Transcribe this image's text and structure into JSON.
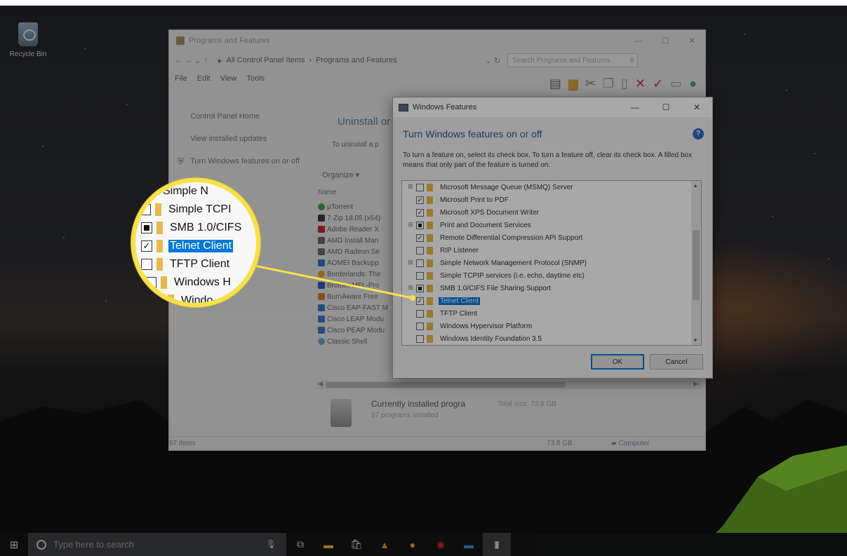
{
  "desktop": {
    "recycle_bin_label": "Recycle Bin"
  },
  "taskbar": {
    "search_placeholder": "Type here to search"
  },
  "programs_window": {
    "title": "Programs and Features",
    "address_path": [
      "All Control Panel Items",
      "Programs and Features"
    ],
    "search_placeholder": "Search Programs and Features",
    "menu": [
      "File",
      "Edit",
      "View",
      "Tools"
    ],
    "left_links": [
      "Control Panel Home",
      "View installed updates",
      "Turn Windows features on or off"
    ],
    "heading": "Uninstall or",
    "subheading": "To uninstall a p",
    "organize": "Organize ▾",
    "column_name": "Name",
    "programs": [
      {
        "name": "µTorrent",
        "color": "#3fa34d"
      },
      {
        "name": "7-Zip 18.05 (x64)",
        "color": "#3a3a3a"
      },
      {
        "name": "Adobe Reader X",
        "color": "#d0231c"
      },
      {
        "name": "AMD Install Man",
        "color": "#6a6a6a"
      },
      {
        "name": "AMD Radeon Se",
        "color": "#6a6a6a"
      },
      {
        "name": "AOMEI Backupp",
        "color": "#2d78c4"
      },
      {
        "name": "Borderlands: The",
        "color": "#e2a12c"
      },
      {
        "name": "Brother MFL-Pro",
        "color": "#2d5ca8"
      },
      {
        "name": "BurnAware Free",
        "color": "#e07a26"
      },
      {
        "name": "Cisco EAP-FAST M",
        "color": "#3579c7"
      },
      {
        "name": "Cisco LEAP Modu",
        "color": "#3579c7"
      },
      {
        "name": "Cisco PEAP Modu",
        "color": "#3579c7"
      },
      {
        "name": "Classic Shell",
        "color": "#5fa7d8"
      }
    ],
    "installed_title": "Currently installed progra",
    "installed_count": "97 programs installed",
    "total_size": "Total size:  73.8 GB",
    "status_items": "97 items",
    "status_size": "73.8 GB",
    "status_computer": "Computer"
  },
  "features_dialog": {
    "title": "Windows Features",
    "heading": "Turn Windows features on or off",
    "help": "?",
    "description": "To turn a feature on, select its check box. To turn a feature off, clear its check box. A filled box means that only part of the feature is turned on.",
    "features": [
      {
        "label": "Microsoft Message Queue (MSMQ) Server",
        "state": "unchecked",
        "expandable": true,
        "selected": false
      },
      {
        "label": "Microsoft Print to PDF",
        "state": "checked",
        "expandable": false,
        "selected": false
      },
      {
        "label": "Microsoft XPS Document Writer",
        "state": "checked",
        "expandable": false,
        "selected": false
      },
      {
        "label": "Print and Document Services",
        "state": "partial",
        "expandable": true,
        "selected": false
      },
      {
        "label": "Remote Differential Compression API Support",
        "state": "checked",
        "expandable": false,
        "selected": false
      },
      {
        "label": "RIP Listener",
        "state": "unchecked",
        "expandable": false,
        "selected": false
      },
      {
        "label": "Simple Network Management Protocol (SNMP)",
        "state": "unchecked",
        "expandable": true,
        "selected": false
      },
      {
        "label": "Simple TCPIP services (i.e. echo, daytime etc)",
        "state": "unchecked",
        "expandable": false,
        "selected": false
      },
      {
        "label": "SMB 1.0/CIFS File Sharing Support",
        "state": "partial",
        "expandable": true,
        "selected": false
      },
      {
        "label": "Telnet Client",
        "state": "checked",
        "expandable": false,
        "selected": true
      },
      {
        "label": "TFTP Client",
        "state": "unchecked",
        "expandable": false,
        "selected": false
      },
      {
        "label": "Windows Hypervisor Platform",
        "state": "unchecked",
        "expandable": false,
        "selected": false
      },
      {
        "label": "Windows Identity Foundation 3.5",
        "state": "unchecked",
        "expandable": false,
        "selected": false
      }
    ],
    "ok": "OK",
    "cancel": "Cancel"
  },
  "magnifier": {
    "rows": [
      {
        "label": "Simple N",
        "state": "unchecked",
        "selected": false
      },
      {
        "label": "Simple TCPI",
        "state": "unchecked",
        "selected": false
      },
      {
        "label": "SMB 1.0/CIFS",
        "state": "partial",
        "selected": false
      },
      {
        "label": "Telnet Client",
        "state": "checked",
        "selected": true
      },
      {
        "label": "TFTP Client",
        "state": "unchecked",
        "selected": false
      },
      {
        "label": "Windows H",
        "state": "unchecked",
        "selected": false
      },
      {
        "label": "Windo",
        "state": "unchecked",
        "selected": false
      }
    ]
  },
  "colors": {
    "accent": "#0078d7",
    "callout": "#f7e14b",
    "heading_blue": "#2b579a"
  }
}
